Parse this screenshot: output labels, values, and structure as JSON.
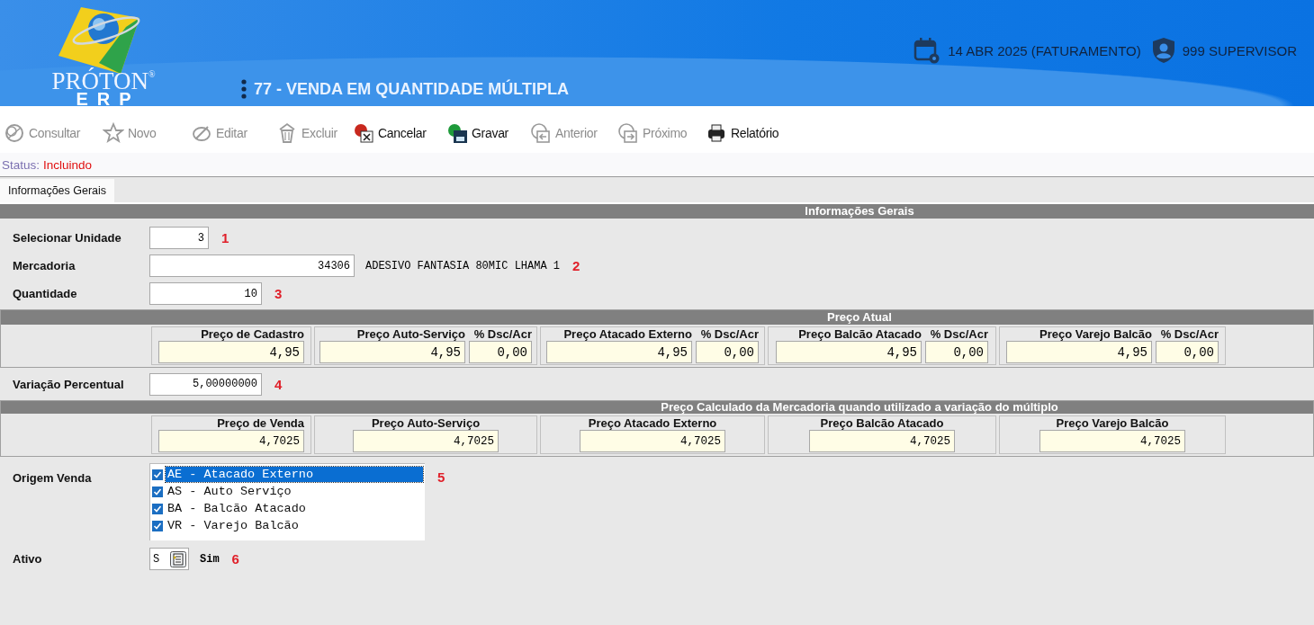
{
  "header": {
    "logo": {
      "name": "PRÓTON",
      "mark": "®",
      "sub": "ERP"
    },
    "title": "77 - VENDA EM QUANTIDADE MÚLTIPLA",
    "date": "14 ABR 2025 (FATURAMENTO)",
    "user": "999 SUPERVISOR"
  },
  "toolbar": [
    {
      "label": "Consultar",
      "disabled": true
    },
    {
      "label": "Novo",
      "disabled": true
    },
    {
      "label": "Editar",
      "disabled": true
    },
    {
      "label": "Excluir",
      "disabled": true
    },
    {
      "label": "Cancelar",
      "disabled": false
    },
    {
      "label": "Gravar",
      "disabled": false
    },
    {
      "label": "Anterior",
      "disabled": true
    },
    {
      "label": "Próximo",
      "disabled": true
    },
    {
      "label": "Relatório",
      "disabled": false
    }
  ],
  "status": {
    "label": "Status:",
    "value": "Incluindo"
  },
  "tabs": [
    {
      "label": "Informações Gerais",
      "selected": true
    }
  ],
  "section_title": "Informações Gerais",
  "fields": [
    {
      "label": "Selecionar Unidade",
      "value": "3",
      "marker": "1"
    },
    {
      "label": "Mercadoria",
      "value": "34306",
      "description": "ADESIVO FANTASIA 80MIC LHAMA 1",
      "marker": "2"
    },
    {
      "label": "Quantidade",
      "value": "10",
      "marker": "3"
    }
  ],
  "preco_atual": {
    "title": "Preço Atual",
    "groups": [
      {
        "fields": [
          {
            "label": "Preço de Cadastro",
            "value": "4,95"
          }
        ]
      },
      {
        "fields": [
          {
            "label": "Preço Auto-Serviço",
            "value": "4,95"
          },
          {
            "label": "% Dsc/Acr",
            "value": "0,00",
            "kind": "percent"
          }
        ]
      },
      {
        "fields": [
          {
            "label": "Preço Atacado Externo",
            "value": "4,95"
          },
          {
            "label": "% Dsc/Acr",
            "value": "0,00",
            "kind": "percent"
          }
        ]
      },
      {
        "fields": [
          {
            "label": "Preço Balcão Atacado",
            "value": "4,95"
          },
          {
            "label": "% Dsc/Acr",
            "value": "0,00",
            "kind": "percent"
          }
        ]
      },
      {
        "fields": [
          {
            "label": "Preço Varejo Balcão",
            "value": "4,95"
          },
          {
            "label": "% Dsc/Acr",
            "value": "0,00",
            "kind": "percent"
          }
        ]
      }
    ]
  },
  "variacao": {
    "label": "Variação Percentual",
    "value": "5,00000000",
    "marker": "4"
  },
  "preco_calculado": {
    "title": "Preço Calculado da Mercadoria quando utilizado a variação do múltiplo",
    "groups": [
      {
        "label": "Preço de Venda",
        "value": "4,7025"
      },
      {
        "label": "Preço Auto-Serviço",
        "value": "4,7025"
      },
      {
        "label": "Preço Atacado Externo",
        "value": "4,7025"
      },
      {
        "label": "Preço Balcão Atacado",
        "value": "4,7025"
      },
      {
        "label": "Preço Varejo Balcão",
        "value": "4,7025"
      }
    ]
  },
  "origem_venda": {
    "label": "Origem Venda",
    "marker": "5",
    "items": [
      {
        "label": "AE - Atacado Externo",
        "checked": true,
        "selected": true
      },
      {
        "label": "AS - Auto Serviço",
        "checked": true,
        "selected": false
      },
      {
        "label": "BA - Balcão Atacado",
        "checked": true,
        "selected": false
      },
      {
        "label": "VR - Varejo Balcão",
        "checked": true,
        "selected": false
      }
    ]
  },
  "ativo": {
    "label": "Ativo",
    "value": "S",
    "description": "Sim",
    "marker": "6"
  }
}
